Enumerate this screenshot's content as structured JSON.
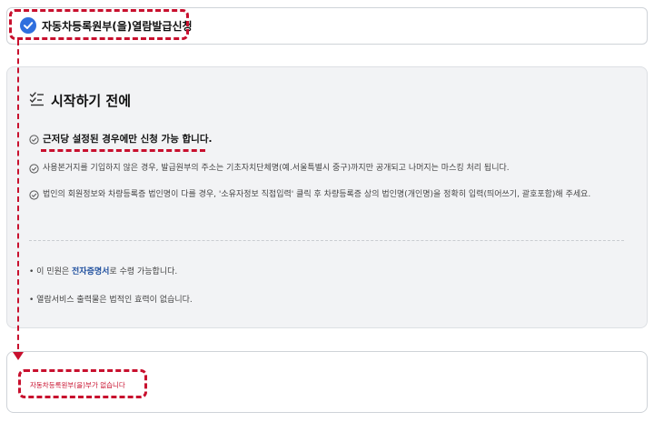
{
  "header": {
    "title": "자동차등록원부(을)열람발급신청",
    "check_icon": "check-circle-icon",
    "accent": "#2f6fde"
  },
  "intro": {
    "title": "시작하기 전에",
    "icon": "checklist-icon",
    "items": [
      {
        "icon": "check-icon",
        "text": "근저당 설정된 경우에만 신청 가능 합니다."
      },
      {
        "icon": "check-icon",
        "text": "사용본거지를 기입하지 않은 경우, 발급원부의 주소는 기초자치단체명(예.서울특별시 중구)까지만 공개되고 나머지는 마스킹 처리 됩니다."
      },
      {
        "icon": "check-icon",
        "text": "법인의 회원정보와 차량등록증 법인명이 다를 경우, '소유자정보 직접입력' 클릭 후 차량등록증 상의 법인명(개인명)을 정확히 입력(띄어쓰기, 괄호포함)해 주세요."
      }
    ],
    "notes": [
      {
        "before": "이 민원은 ",
        "emphasis": "전자증명서",
        "after": "로 수령 가능합니다."
      },
      {
        "before": "열람서비스 출력물은 법적인 효력이 없습니다.",
        "emphasis": "",
        "after": ""
      }
    ]
  },
  "result": {
    "empty_message": "자동차등록원부(을)부가 없습니다"
  },
  "colors": {
    "highlight": "#c8102e",
    "link_blue": "#1f4f9e"
  }
}
